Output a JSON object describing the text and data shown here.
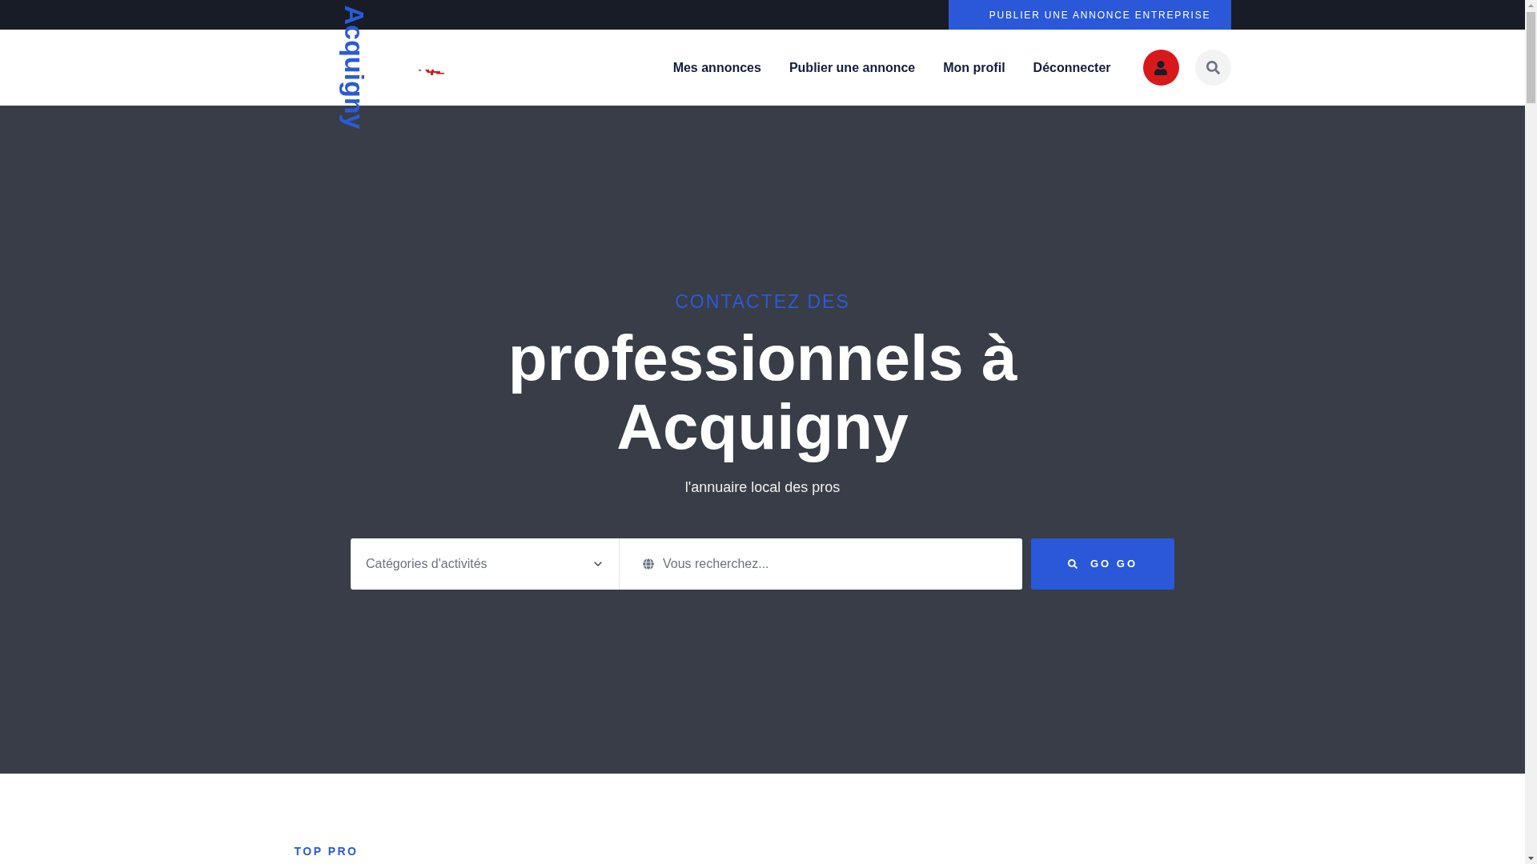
{
  "top_bar": {
    "button": "PUBLIER UNE ANNONCE ENTREPRISE"
  },
  "header": {
    "logo": "Acquigny",
    "nav": [
      "Mes annonces",
      "Publier une annonce",
      "Mon profil",
      "Déconnecter"
    ]
  },
  "hero": {
    "eyebrow": "CONTACTEZ DES",
    "title": "professionnels à Acquigny",
    "subtitle": "l'annuaire local des pros",
    "search": {
      "category": {
        "placeholder": "Catégories d'activités"
      },
      "query": {
        "placeholder": "Vous recherchez..."
      },
      "button": "GO GO"
    }
  },
  "section": {
    "heading": "TOP PRO"
  }
}
